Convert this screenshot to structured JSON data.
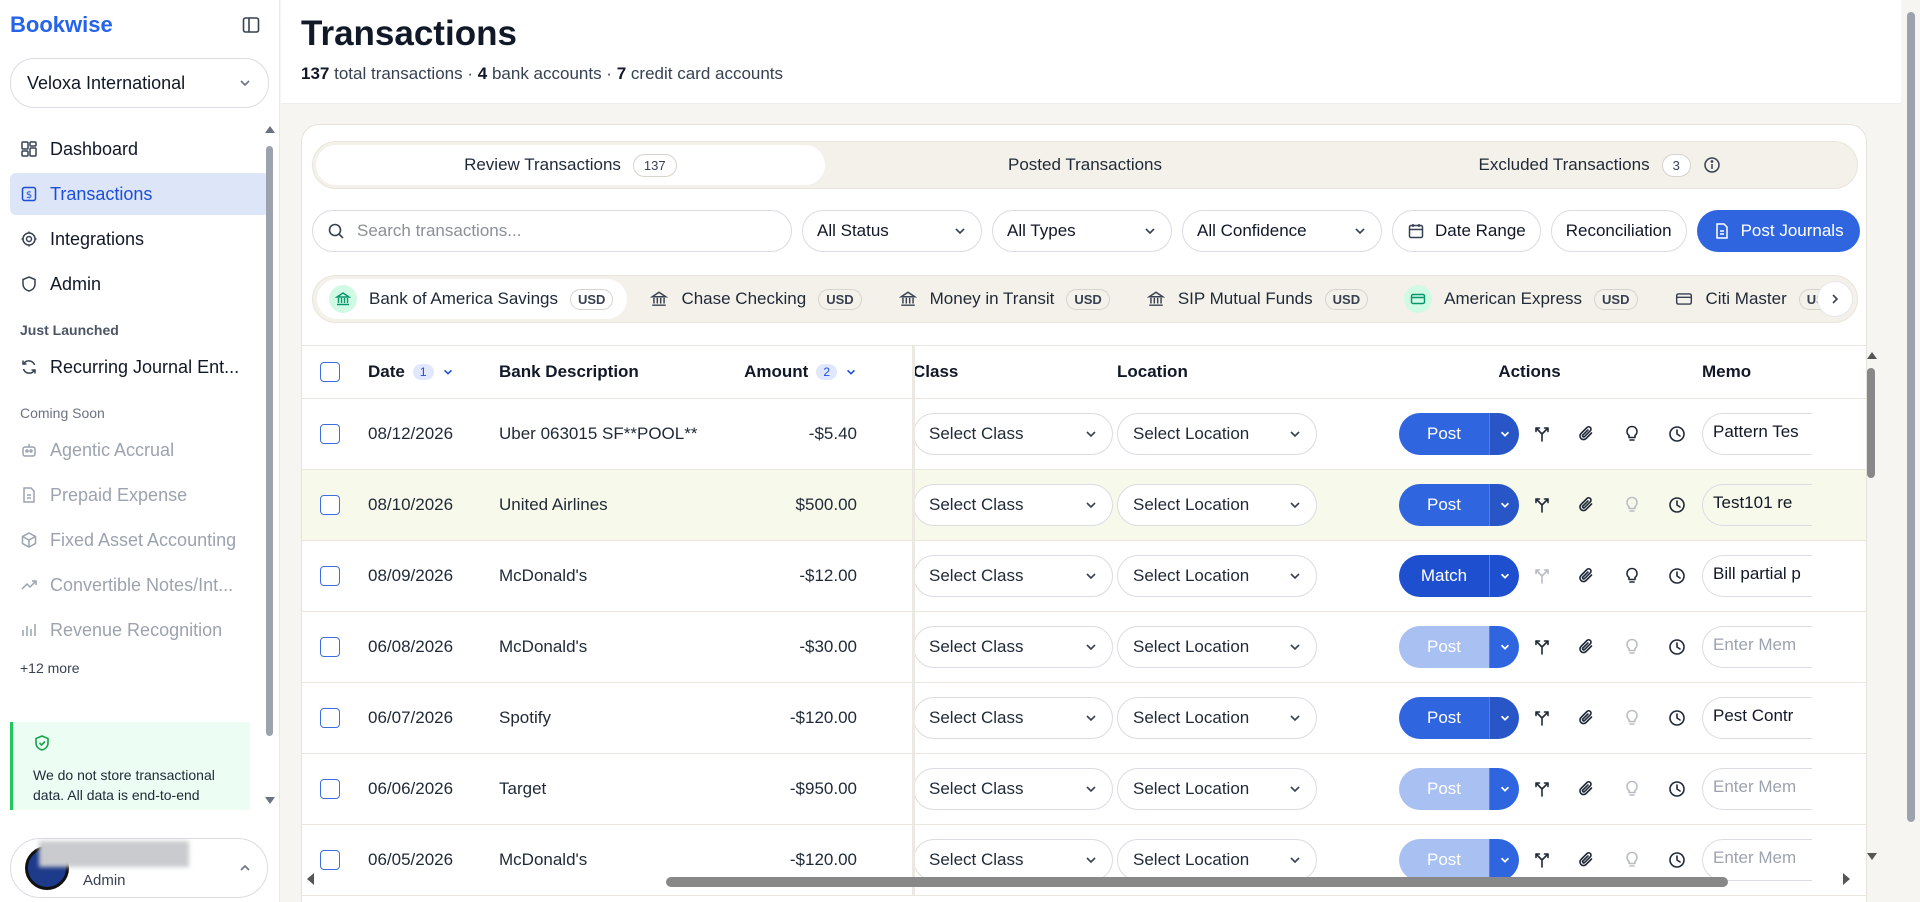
{
  "sidebar": {
    "brand": "Bookwise",
    "org": "Veloxa International",
    "nav": [
      {
        "label": "Dashboard"
      },
      {
        "label": "Transactions"
      },
      {
        "label": "Integrations"
      },
      {
        "label": "Admin"
      }
    ],
    "just_launched_title": "Just Launched",
    "just_launched": [
      {
        "label": "Recurring Journal Ent..."
      }
    ],
    "coming_soon_title": "Coming Soon",
    "coming_soon": [
      {
        "label": "Agentic Accrual"
      },
      {
        "label": "Prepaid Expense"
      },
      {
        "label": "Fixed Asset Accounting"
      },
      {
        "label": "Convertible Notes/Int..."
      },
      {
        "label": "Revenue Recognition"
      }
    ],
    "more": "+12 more",
    "notice": "We do not store transactional data. All data is end-to-end encrypted.",
    "user_role": "Admin"
  },
  "header": {
    "title": "Transactions",
    "total_count": "137",
    "total_label": "total transactions ·",
    "bank_count": "4",
    "bank_label": "bank accounts ·",
    "cc_count": "7",
    "cc_label": "credit card accounts"
  },
  "tabs": [
    {
      "label": "Review Transactions",
      "count": "137"
    },
    {
      "label": "Posted Transactions",
      "count": ""
    },
    {
      "label": "Excluded Transactions",
      "count": "3"
    }
  ],
  "filters": {
    "search_placeholder": "Search transactions...",
    "status": "All Status",
    "types": "All Types",
    "confidence": "All Confidence",
    "date_range": "Date Range",
    "reconciliation": "Reconciliation",
    "post_journals": "Post Journals"
  },
  "accounts": [
    {
      "name": "Bank of America Savings",
      "currency": "USD"
    },
    {
      "name": "Chase Checking",
      "currency": "USD"
    },
    {
      "name": "Money in Transit",
      "currency": "USD"
    },
    {
      "name": "SIP Mutual Funds",
      "currency": "USD"
    },
    {
      "name": "American Express",
      "currency": "USD"
    },
    {
      "name": "Citi Master",
      "currency": "USD"
    }
  ],
  "table": {
    "headers": {
      "date": "Date",
      "date_sort": "1",
      "desc": "Bank Description",
      "amount": "Amount",
      "amount_sort": "2",
      "class": "Class",
      "location": "Location",
      "actions": "Actions",
      "memo": "Memo"
    },
    "class_placeholder": "Select Class",
    "location_placeholder": "Select Location",
    "rows": [
      {
        "date": "08/12/2026",
        "desc": "Uber 063015 SF**POOL**",
        "amount": "-$5.40",
        "action": "Post",
        "memo": "Pattern Tes"
      },
      {
        "date": "08/10/2026",
        "desc": "United Airlines",
        "amount": "$500.00",
        "action": "Post",
        "memo": "Test101 re"
      },
      {
        "date": "08/09/2026",
        "desc": "McDonald's",
        "amount": "-$12.00",
        "action": "Match",
        "memo": "Bill partial p"
      },
      {
        "date": "06/08/2026",
        "desc": "McDonald's",
        "amount": "-$30.00",
        "action": "Post",
        "memo": "Enter Mem"
      },
      {
        "date": "06/07/2026",
        "desc": "Spotify",
        "amount": "-$120.00",
        "action": "Post",
        "memo": "Pest Contr"
      },
      {
        "date": "06/06/2026",
        "desc": "Target",
        "amount": "-$950.00",
        "action": "Post",
        "memo": "Enter Mem"
      },
      {
        "date": "06/05/2026",
        "desc": "McDonald's",
        "amount": "-$120.00",
        "action": "Post",
        "memo": "Enter Mem"
      }
    ]
  }
}
